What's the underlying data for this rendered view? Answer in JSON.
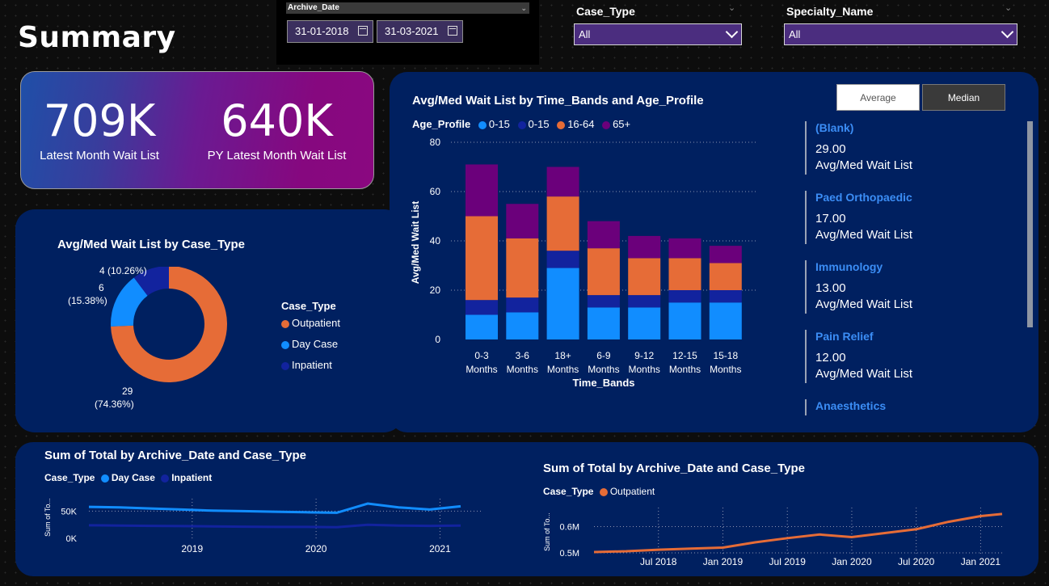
{
  "page": {
    "title": "Summary"
  },
  "date_slicer": {
    "label": "Archive_Date",
    "start": "31-01-2018",
    "end": "31-03-2021"
  },
  "case_type_slicer": {
    "label": "Case_Type",
    "value": "All"
  },
  "specialty_slicer": {
    "label": "Specialty_Name",
    "value": "All"
  },
  "kpis": {
    "latest": {
      "value": "709K",
      "label": "Latest Month Wait List"
    },
    "py_latest": {
      "value": "640K",
      "label": "PY Latest Month Wait List"
    }
  },
  "donut": {
    "title": "Avg/Med Wait List by Case_Type",
    "legend_title": "Case_Type",
    "labels": {
      "inpatient_top": "4 (10.26%)",
      "daycase_a": "6",
      "daycase_b": "(15.38%)",
      "outpatient_a": "29",
      "outpatient_b": "(74.36%)"
    }
  },
  "stacked": {
    "title": "Avg/Med Wait List by Time_Bands and Age_Profile",
    "legend_title": "Age_Profile",
    "ylabel": "Avg/Med Wait List",
    "xlabel": "Time_Bands",
    "tick_labels": [
      "0",
      "20",
      "40",
      "60",
      "80"
    ],
    "cat_line1": [
      "0-3",
      "3-6",
      "18+",
      "6-9",
      "9-12",
      "12-15",
      "15-18"
    ],
    "cat_line2": [
      "Months",
      "Months",
      "Months",
      "Months",
      "Months",
      "Months",
      "Months"
    ]
  },
  "toggle": {
    "average": "Average",
    "median": "Median"
  },
  "specialty_cards": [
    {
      "name": "(Blank)",
      "value": "29.00",
      "label": "Avg/Med Wait List"
    },
    {
      "name": "Paed Orthopaedic",
      "value": "17.00",
      "label": "Avg/Med Wait List"
    },
    {
      "name": "Immunology",
      "value": "13.00",
      "label": "Avg/Med Wait List"
    },
    {
      "name": "Pain Relief",
      "value": "12.00",
      "label": "Avg/Med Wait List"
    },
    {
      "name": "Anaesthetics",
      "value": "",
      "label": ""
    }
  ],
  "line_left": {
    "title": "Sum of Total by Archive_Date and Case_Type",
    "legend_title": "Case_Type",
    "ylabel": "Sum of To...",
    "yticks": [
      "50K",
      "0K"
    ],
    "xticks": [
      "2019",
      "2020",
      "2021"
    ]
  },
  "line_right": {
    "title": "Sum of Total by Archive_Date and Case_Type",
    "legend_title": "Case_Type",
    "ylabel": "Sum of To...",
    "yticks": [
      "0.6M",
      "0.5M"
    ],
    "xticks": [
      "Jul 2018",
      "Jan 2019",
      "Jul 2019",
      "Jan 2020",
      "Jul 2020",
      "Jan 2021"
    ]
  },
  "colors": {
    "outpatient": "#e66c37",
    "daycase": "#118dff",
    "inpatient": "#12239e",
    "age_0_15_light": "#118dff",
    "age_0_15_dark": "#12239e",
    "age_16_64": "#e66c37",
    "age_65": "#6b007b",
    "panel": "#002060"
  },
  "chart_data": [
    {
      "type": "pie",
      "title": "Avg/Med Wait List by Case_Type",
      "legend": "Case_Type",
      "categories": [
        "Outpatient",
        "Day Case",
        "Inpatient"
      ],
      "values": [
        29,
        6,
        4
      ],
      "percent": [
        74.36,
        15.38,
        10.26
      ]
    },
    {
      "type": "bar",
      "stacked": true,
      "title": "Avg/Med Wait List by Time_Bands and Age_Profile",
      "xlabel": "Time_Bands",
      "ylabel": "Avg/Med Wait List",
      "legend": "Age_Profile",
      "ylim": [
        0,
        80
      ],
      "categories": [
        "0-3 Months",
        "3-6 Months",
        "18+ Months",
        "6-9 Months",
        "9-12 Months",
        "12-15 Months",
        "15-18 Months"
      ],
      "series": [
        {
          "name": "0-15",
          "values": [
            10,
            11,
            29,
            13,
            13,
            15,
            15
          ]
        },
        {
          "name": "0-15",
          "values": [
            6,
            6,
            7,
            5,
            5,
            5,
            5
          ]
        },
        {
          "name": "16-64",
          "values": [
            34,
            24,
            22,
            19,
            15,
            13,
            11
          ]
        },
        {
          "name": "65+",
          "values": [
            21,
            14,
            12,
            11,
            9,
            8,
            7
          ]
        }
      ]
    },
    {
      "type": "line",
      "title": "Sum of Total by Archive_Date and Case_Type",
      "legend": "Case_Type",
      "ylabel": "Sum of To...",
      "x": [
        "2018-03",
        "2018-06",
        "2018-09",
        "2018-12",
        "2019-03",
        "2019-06",
        "2019-09",
        "2019-12",
        "2020-03",
        "2020-06",
        "2020-09",
        "2020-12",
        "2021-03"
      ],
      "series": [
        {
          "name": "Day Case",
          "values": [
            58000,
            57000,
            55000,
            53000,
            51000,
            50000,
            49000,
            48000,
            47000,
            64000,
            57000,
            53000,
            59000
          ]
        },
        {
          "name": "Inpatient",
          "values": [
            24000,
            23500,
            23000,
            22500,
            22000,
            21500,
            21000,
            21000,
            20500,
            25000,
            23500,
            23000,
            23500
          ]
        }
      ]
    },
    {
      "type": "line",
      "title": "Sum of Total by Archive_Date and Case_Type",
      "legend": "Case_Type",
      "ylabel": "Sum of To...",
      "x": [
        "2018-01",
        "2018-04",
        "2018-07",
        "2018-10",
        "2019-01",
        "2019-04",
        "2019-07",
        "2019-10",
        "2020-01",
        "2020-04",
        "2020-07",
        "2020-10",
        "2021-01",
        "2021-03"
      ],
      "series": [
        {
          "name": "Outpatient",
          "values": [
            503000,
            506000,
            512000,
            516000,
            520000,
            540000,
            556000,
            570000,
            560000,
            575000,
            590000,
            618000,
            640000,
            648000
          ]
        }
      ]
    }
  ]
}
